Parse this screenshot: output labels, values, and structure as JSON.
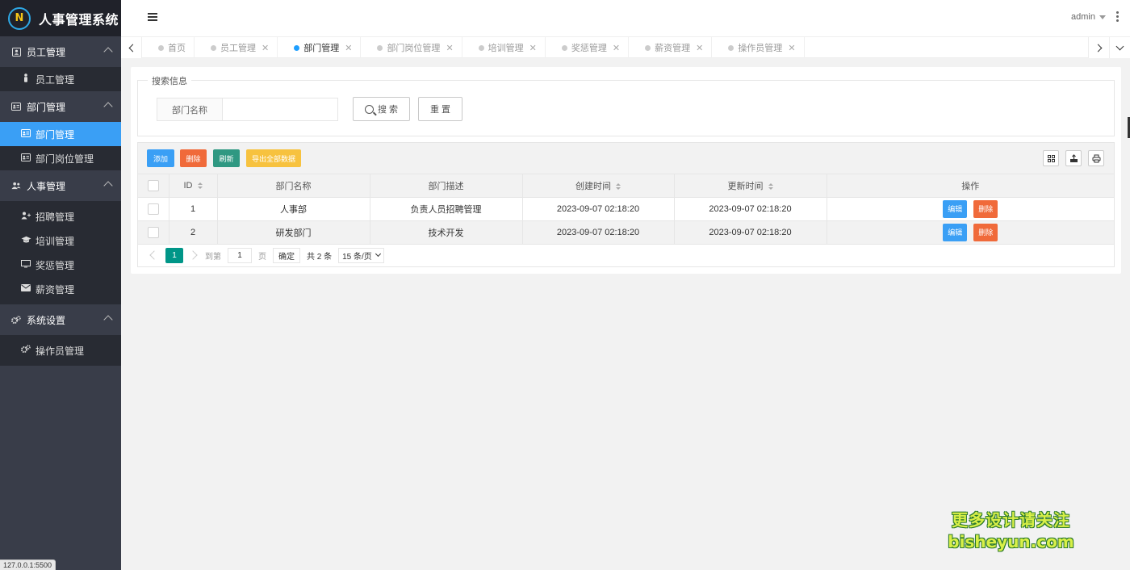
{
  "app": {
    "title": "人事管理系统",
    "logo_letter": "N"
  },
  "sidebar": {
    "groups": [
      {
        "label": "员工管理",
        "icon": "id-card-icon",
        "items": [
          {
            "label": "员工管理",
            "icon": "person-icon"
          }
        ]
      },
      {
        "label": "部门管理",
        "icon": "address-card-icon",
        "items": [
          {
            "label": "部门管理",
            "icon": "address-card-icon",
            "active": true
          },
          {
            "label": "部门岗位管理",
            "icon": "address-card-icon"
          }
        ]
      },
      {
        "label": "人事管理",
        "icon": "users-icon",
        "items": [
          {
            "label": "招聘管理",
            "icon": "user-plus-icon"
          },
          {
            "label": "培训管理",
            "icon": "graduation-cap-icon"
          },
          {
            "label": "奖惩管理",
            "icon": "monitor-icon"
          },
          {
            "label": "薪资管理",
            "icon": "envelope-icon"
          }
        ]
      },
      {
        "label": "系统设置",
        "icon": "gears-icon",
        "items": [
          {
            "label": "操作员管理",
            "icon": "gears-icon"
          }
        ]
      }
    ]
  },
  "status_bar": {
    "url": "127.0.0.1:5500"
  },
  "header": {
    "user": "admin"
  },
  "tabs": [
    {
      "label": "首页",
      "closable": false,
      "active": false
    },
    {
      "label": "员工管理",
      "closable": true,
      "active": false
    },
    {
      "label": "部门管理",
      "closable": true,
      "active": true
    },
    {
      "label": "部门岗位管理",
      "closable": true,
      "active": false
    },
    {
      "label": "培训管理",
      "closable": true,
      "active": false
    },
    {
      "label": "奖惩管理",
      "closable": true,
      "active": false
    },
    {
      "label": "薪资管理",
      "closable": true,
      "active": false
    },
    {
      "label": "操作员管理",
      "closable": true,
      "active": false
    }
  ],
  "search": {
    "legend": "搜索信息",
    "field_label": "部门名称",
    "field_value": "",
    "search_label": "搜 索",
    "reset_label": "重 置"
  },
  "toolbar": {
    "add_label": "添加",
    "delete_label": "删除",
    "refresh_label": "刷新",
    "export_label": "导出全部数据"
  },
  "table": {
    "columns": [
      "ID",
      "部门名称",
      "部门描述",
      "创建时间",
      "更新时间",
      "操作"
    ],
    "rows": [
      {
        "id": "1",
        "name": "人事部",
        "desc": "负责人员招聘管理",
        "created": "2023-09-07 02:18:20",
        "updated": "2023-09-07 02:18:20"
      },
      {
        "id": "2",
        "name": "研发部门",
        "desc": "技术开发",
        "created": "2023-09-07 02:18:20",
        "updated": "2023-09-07 02:18:20"
      }
    ],
    "edit_label": "编辑",
    "delete_label": "删除"
  },
  "pager": {
    "current": "1",
    "goto_label": "到第",
    "goto_value": "1",
    "page_unit": "页",
    "ok_label": "确定",
    "total": "共 2 条",
    "page_size": "15 条/页"
  },
  "watermark": {
    "line1": "更多设计请关注",
    "line2": "bisheyun.com"
  },
  "colors": {
    "accent": "#3a9ff5",
    "danger": "#f06a3a",
    "success": "#2f9882",
    "warning": "#f7c23f",
    "sidebar": "#393d49"
  }
}
